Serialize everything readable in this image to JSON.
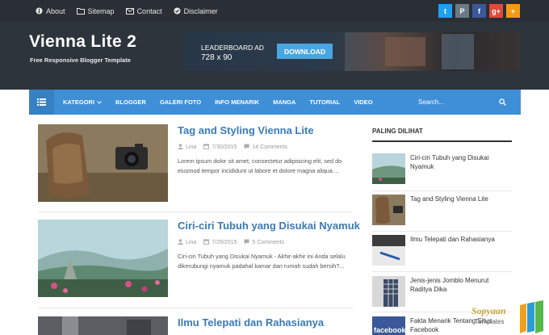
{
  "topbar": {
    "links": [
      {
        "label": "About",
        "icon": "info-circle-icon"
      },
      {
        "label": "Sitemap",
        "icon": "folder-icon"
      },
      {
        "label": "Contact",
        "icon": "envelope-icon"
      },
      {
        "label": "Disclaimer",
        "icon": "check-circle-icon"
      }
    ],
    "social": [
      {
        "icon": "twitter-icon",
        "glyph": "t",
        "color": "#1da1f2"
      },
      {
        "icon": "pinterest-icon",
        "glyph": "P",
        "color": "#6b7a86"
      },
      {
        "icon": "facebook-icon",
        "glyph": "f",
        "color": "#3b5998"
      },
      {
        "icon": "google-plus-icon",
        "glyph": "g+",
        "color": "#dd4b39"
      },
      {
        "icon": "plus-icon",
        "glyph": "+",
        "color": "#f39c12"
      }
    ]
  },
  "header": {
    "title": "Vienna Lite 2",
    "tagline": "Free Responsive Blogger Template",
    "ad": {
      "line1": "LEADERBOARD AD",
      "line2": "728 x 90",
      "button": "DOWNLOAD"
    }
  },
  "nav": {
    "menu_icon": "menu-icon",
    "items": [
      "KATEGORI",
      "BLOGGER",
      "GALERI FOTO",
      "INFO MENARIK",
      "MANGA",
      "TUTORIAL",
      "VIDEO"
    ],
    "search_placeholder": "Search..."
  },
  "posts": [
    {
      "title": "Tag and Styling Vienna Lite",
      "author": "Lina",
      "date": "7/30/2015",
      "comments": "14 Comments",
      "excerpt": "Lorem ipsum dolor sit amet, consectetur adipisicing elit, sed do eiusmod tempor incididunt ut labore et dolore magna aliqua...."
    },
    {
      "title": "Ciri-ciri Tubuh yang Disukai Nyamuk",
      "author": "Lina",
      "date": "7/29/2015",
      "comments": "5 Comments",
      "excerpt": "Ciri-ciri Tubuh yang Disukai Nyamuk - Akhir-akhir ini Anda selalu dikerubungi nyamuk padahal kamar dan rumah sudah bersih?..."
    },
    {
      "title": "Ilmu Telepati dan Rahasianya"
    }
  ],
  "sidebar": {
    "title": "PALING DILIHAT",
    "items": [
      "Ciri-ciri Tubuh yang Disukai Nyamuk",
      "Tag and Styling Vienna Lite",
      "Ilmu Telepati dan Rahasianya",
      "Jenis-jenis Jomblo Menurut Raditya Dika",
      "Fakta Menarik Tentang Situs Facebook"
    ]
  },
  "watermark": {
    "line1": "Sopyaan",
    "line2": "Templates"
  }
}
